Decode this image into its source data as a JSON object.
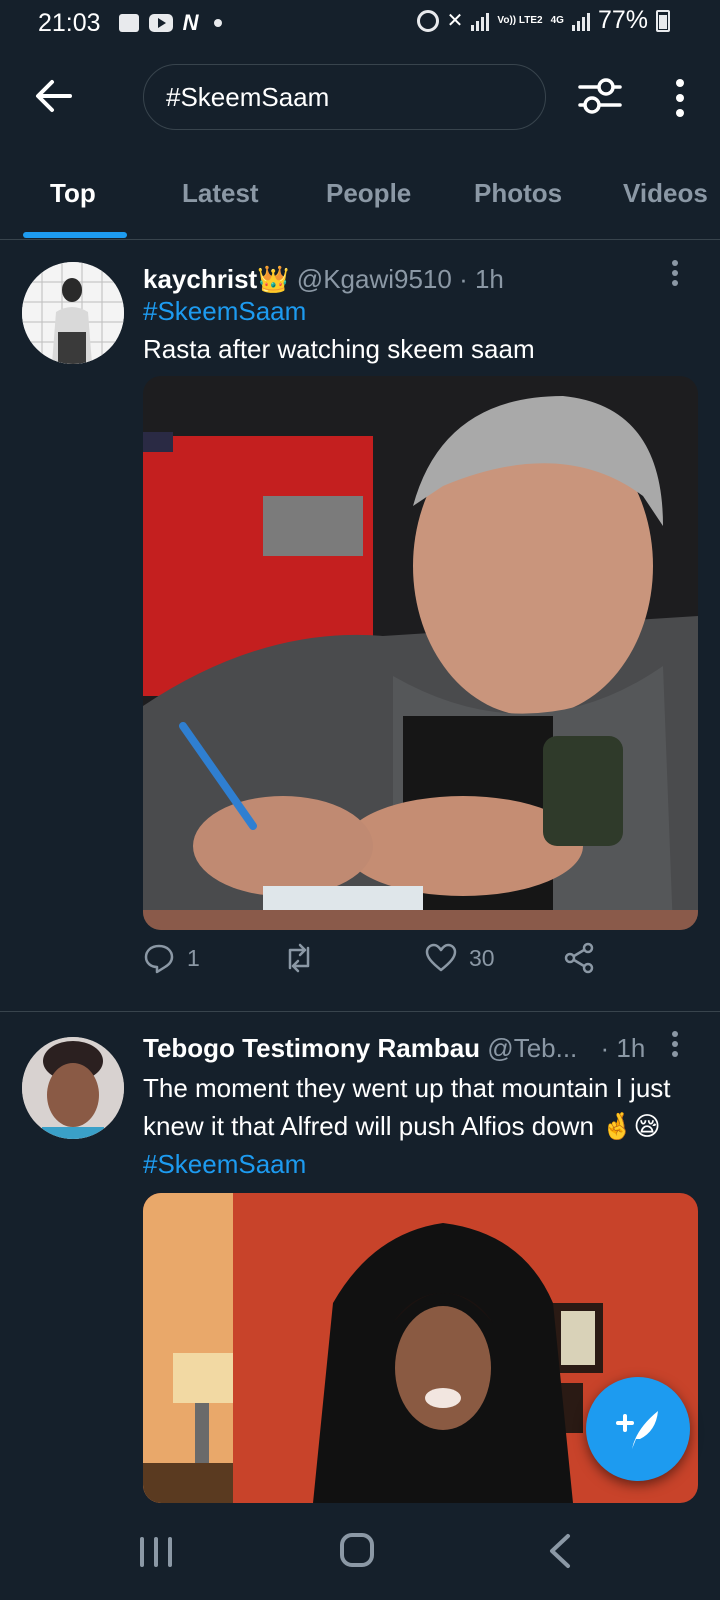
{
  "status_bar": {
    "time": "21:03",
    "battery": "77%",
    "network_label": "Vo)) LTE2",
    "network_type": "4G"
  },
  "header": {
    "search_value": "#SkeemSaam",
    "icons": [
      "back-arrow-icon",
      "filter-sliders-icon",
      "more-vertical-icon"
    ]
  },
  "tabs": [
    {
      "label": "Top",
      "active": true
    },
    {
      "label": "Latest",
      "active": false
    },
    {
      "label": "People",
      "active": false
    },
    {
      "label": "Photos",
      "active": false
    },
    {
      "label": "Videos",
      "active": false
    }
  ],
  "tweets": [
    {
      "name": "kaychrist👑",
      "handle": "@Kgawi9510",
      "time": "· 1h",
      "hashtag": "#SkeemSaam",
      "text": "Rasta after watching skeem saam",
      "replies": "1",
      "retweets": "",
      "likes": "30"
    },
    {
      "name": "Tebogo Testimony Rambau",
      "handle": "@Teb...",
      "time": "· 1h",
      "text": "The moment they went up that mountain I just knew it that Alfred will push Alfios down 🤞😪",
      "hashtag": "#SkeemSaam"
    }
  ],
  "colors": {
    "background": "#15202b",
    "accent": "#1d9bf0",
    "secondary_text": "#8b98a5",
    "divider": "#38444d"
  }
}
